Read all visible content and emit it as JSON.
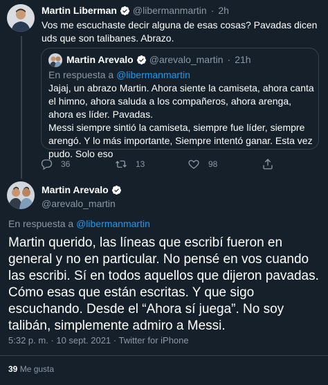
{
  "top_tweet": {
    "author_name": "Martin Liberman",
    "author_handle": "@libermanmartin",
    "separator": "·",
    "time": "2h",
    "text": "Vos me escuchaste decir alguna de esas cosas? Pavadas dicen uds que son talibanes. Abrazo."
  },
  "quoted_tweet": {
    "author_name": "Martin Arevalo",
    "author_handle": "@arevalo_martin",
    "separator": "·",
    "time": "21h",
    "reply_prefix": "En respuesta a",
    "reply_to": "@libermanmartin",
    "text_line_1": "Jajaj, un abrazo Martin. Ahora siente la camiseta, ahora canta el himno, ahora saluda a los compañeros, ahora arenga, ahora es líder. Pavadas.",
    "text_line_2": "Messi siempre sintió la camiseta, siempre fue líder, siempre arengó. Y lo más importante, Siempre intentó ganar. Esta vez pudo. Solo eso"
  },
  "actions": {
    "replies": "36",
    "retweets": "13",
    "likes": "98",
    "icons": [
      "reply-icon",
      "retweet-icon",
      "like-icon",
      "share-icon"
    ]
  },
  "main_tweet": {
    "author_name": "Martin Arevalo",
    "author_handle": "@arevalo_martin",
    "reply_prefix": "En respuesta a",
    "reply_to": "@libermanmartin",
    "text": "Martin querido, las líneas que escribí fueron en general y no en particular. No pensé en vos cuando las escribi. Sí en todos aquellos que dijeron pavadas. Cómo esas que están escritas. Y que sigo escuchando. Desde el “Ahora sí juega”. No soy talibán, simplemente admiro a Messi.",
    "timestamp": "5:32 p. m. · 10 sept. 2021 · Twitter for iPhone",
    "like_count": "39",
    "like_label": "Me gusta"
  },
  "colors": {
    "background": "#15202b",
    "accent": "#1d9bf0",
    "muted": "#8b98a5",
    "border": "#38444d"
  }
}
